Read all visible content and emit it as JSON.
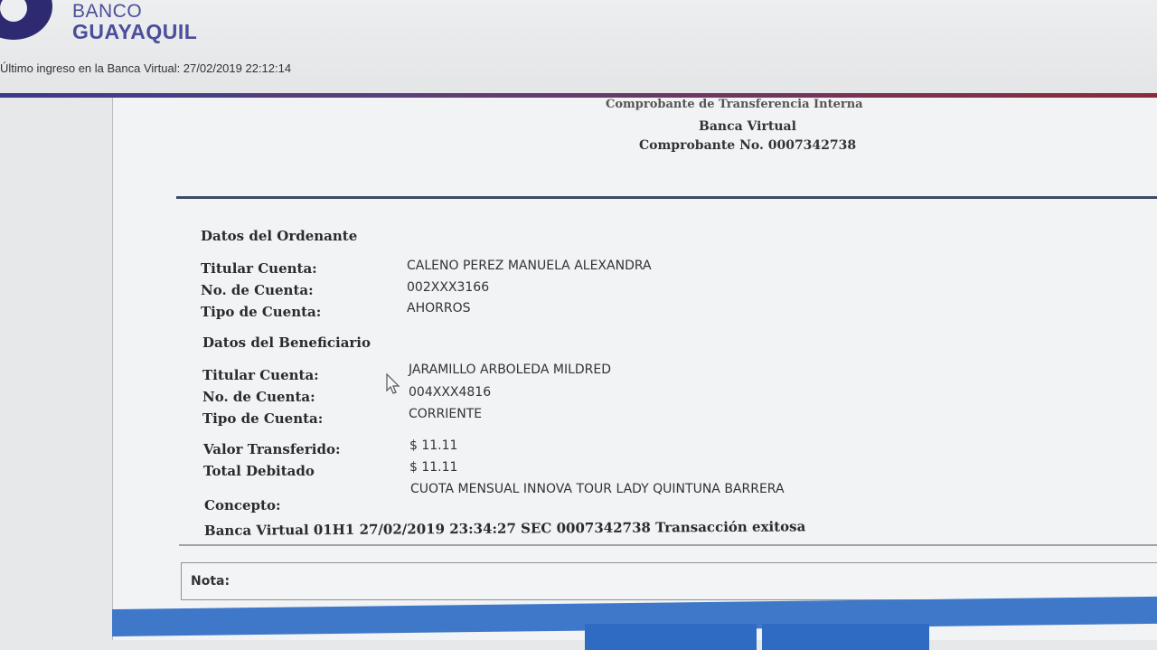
{
  "brand": {
    "line1": "BANCO",
    "line2": "GUAYAQUIL"
  },
  "last_login": "Último ingreso en la Banca Virtual:  27/02/2019 22:12:14",
  "receipt": {
    "heading_partial": "Comprobante de Transferencia Interna",
    "subtitle": "Banca Virtual",
    "number": "Comprobante No. 0007342738"
  },
  "ordenante": {
    "section_title": "Datos del Ordenante",
    "titular_label": "Titular Cuenta:",
    "titular_value": "CALENO PEREZ MANUELA ALEXANDRA",
    "cuenta_label": "No. de Cuenta:",
    "cuenta_value": "002XXX3166",
    "tipo_label": "Tipo de Cuenta:",
    "tipo_value": "AHORROS"
  },
  "beneficiario": {
    "section_title": "Datos del Beneficiario",
    "titular_label": "Titular Cuenta:",
    "titular_value": "JARAMILLO ARBOLEDA MILDRED",
    "cuenta_label": "No. de Cuenta:",
    "cuenta_value": "004XXX4816",
    "tipo_label": "Tipo de Cuenta:",
    "tipo_value": "CORRIENTE"
  },
  "amounts": {
    "valor_label": "Valor Transferido:",
    "valor_value": "$ 11.11",
    "total_label": "Total Debitado",
    "total_value": "$ 11.11"
  },
  "concepto": {
    "label": "Concepto:",
    "value": "CUOTA MENSUAL INNOVA TOUR LADY QUINTUNA BARRERA"
  },
  "status_line": "Banca Virtual 01H1 27/02/2019 23:34:27 SEC 0007342738 Transacción exitosa",
  "nota": {
    "label": "Nota:"
  },
  "buttons": {
    "left": "",
    "right": ""
  },
  "colors": {
    "brand": "#2e2a72",
    "accent_blue": "#3f78c8",
    "rule_red": "#8b2b3a"
  }
}
